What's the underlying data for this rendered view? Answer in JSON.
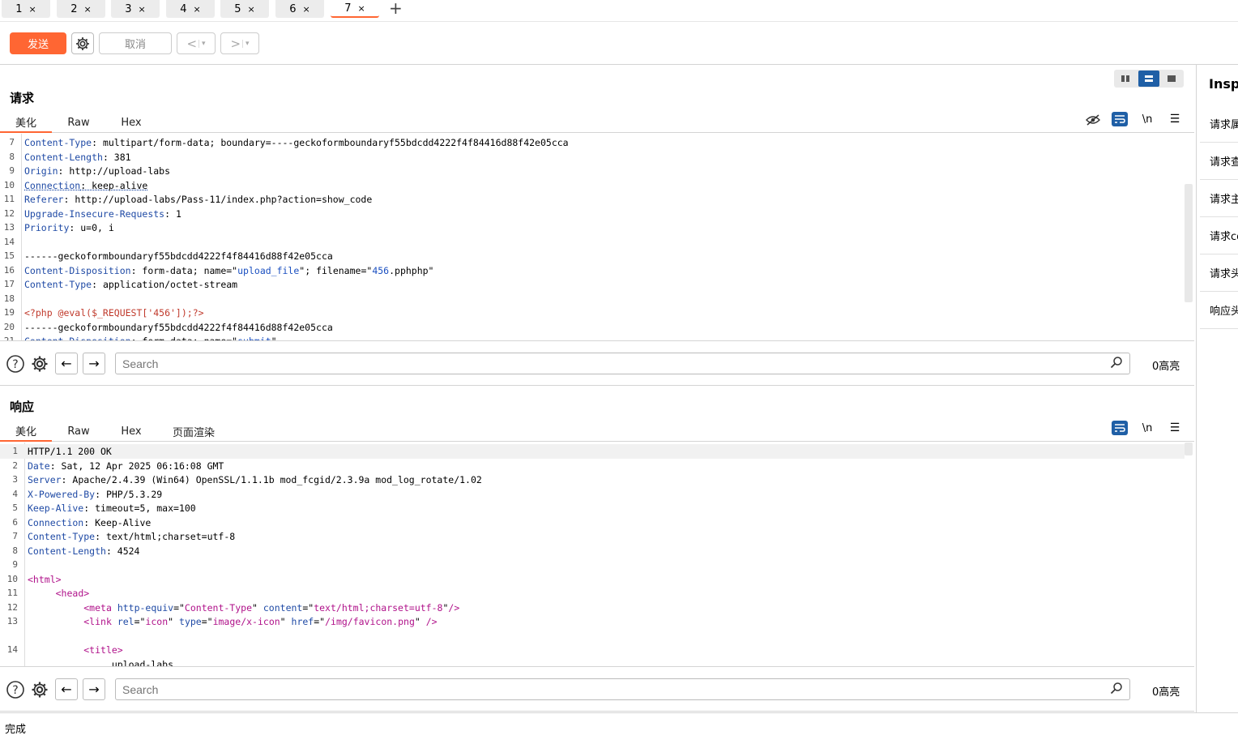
{
  "tabs": [
    {
      "label": "1",
      "close": "×"
    },
    {
      "label": "2",
      "close": "×"
    },
    {
      "label": "3",
      "close": "×"
    },
    {
      "label": "4",
      "close": "×"
    },
    {
      "label": "5",
      "close": "×"
    },
    {
      "label": "6",
      "close": "×"
    },
    {
      "label": "7",
      "close": "×"
    }
  ],
  "active_tab": "7",
  "tab_add": "+",
  "toolbar": {
    "send": "发送",
    "cancel": "取消",
    "back": "<",
    "forward": ">",
    "dropdown": "▾"
  },
  "request": {
    "title": "请求",
    "tabs": [
      "美化",
      "Raw",
      "Hex"
    ],
    "newline_icon": "\\n",
    "search_placeholder": "Search",
    "highlight_count": "0高亮"
  },
  "response": {
    "title": "响应",
    "tabs": [
      "美化",
      "Raw",
      "Hex",
      "页面渲染"
    ],
    "newline_icon": "\\n",
    "search_placeholder": "Search",
    "highlight_count": "0高亮"
  },
  "inspector": {
    "title": "Inspe",
    "items": [
      "请求属",
      "请求查",
      "请求主",
      "请求co",
      "请求头",
      "响应头"
    ]
  },
  "status": "完成",
  "colors": {
    "accent": "#ff6633",
    "blue": "#1f5fa6"
  }
}
